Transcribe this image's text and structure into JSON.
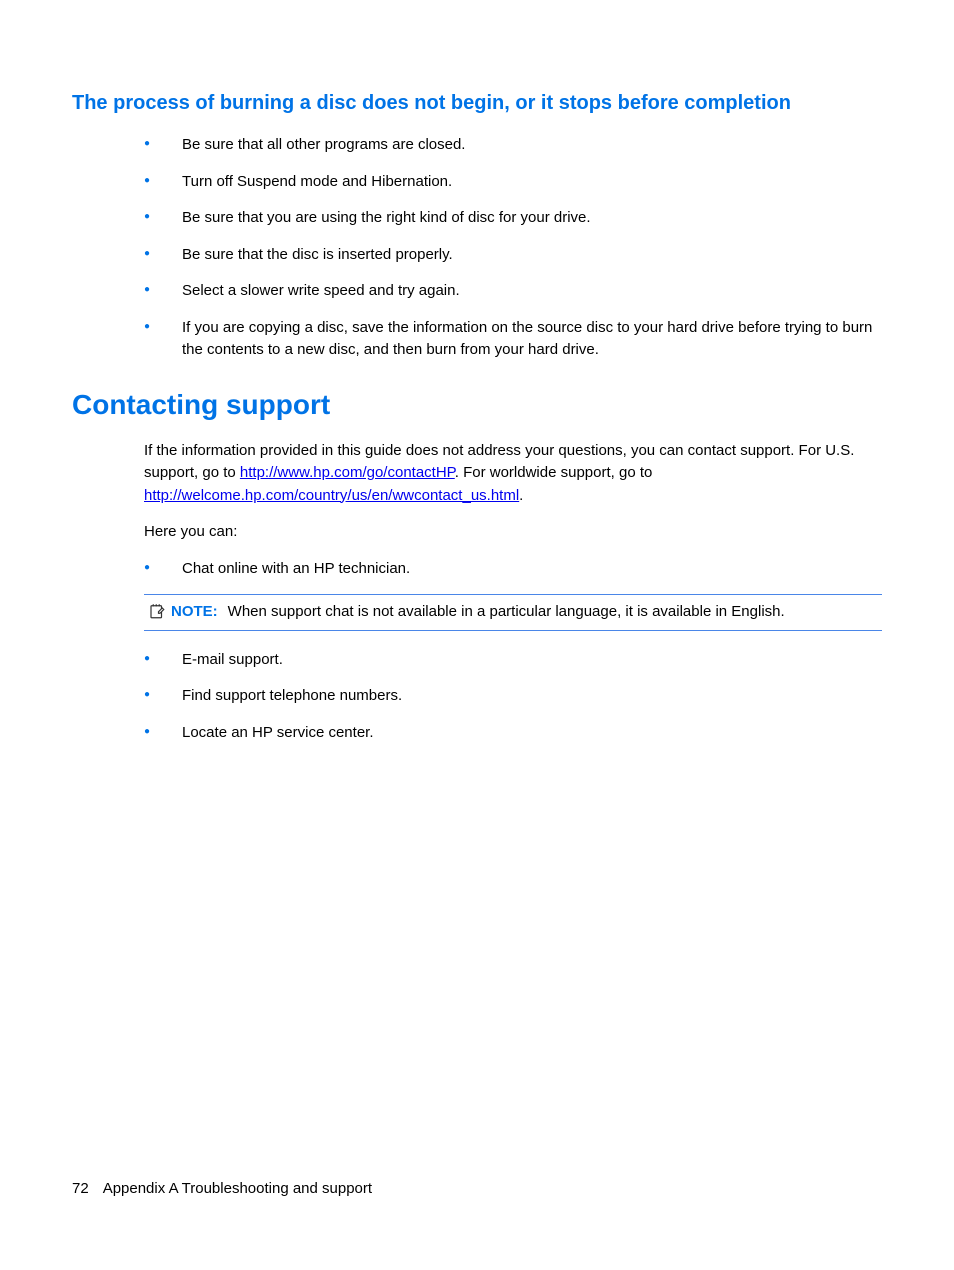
{
  "section1": {
    "heading": "The process of burning a disc does not begin, or it stops before completion",
    "bullets": [
      "Be sure that all other programs are closed.",
      "Turn off Suspend mode and Hibernation.",
      "Be sure that you are using the right kind of disc for your drive.",
      "Be sure that the disc is inserted properly.",
      "Select a slower write speed and try again.",
      "If you are copying a disc, save the information on the source disc to your hard drive before trying to burn the contents to a new disc, and then burn from your hard drive."
    ]
  },
  "section2": {
    "heading": "Contacting support",
    "intro_pre": "If the information provided in this guide does not address your questions, you can contact support. For U.S. support, go to ",
    "link1": "http://www.hp.com/go/contactHP",
    "intro_mid": ". For worldwide support, go to ",
    "link2": "http://welcome.hp.com/country/us/en/wwcontact_us.html",
    "intro_end": ".",
    "here_you_can": "Here you can:",
    "bullet1": "Chat online with an HP technician.",
    "note_label": "NOTE:",
    "note_text": "When support chat is not available in a particular language, it is available in English.",
    "bullets_after": [
      "E-mail support.",
      "Find support telephone numbers.",
      "Locate an HP service center."
    ]
  },
  "footer": {
    "page": "72",
    "appendix": "Appendix A   Troubleshooting and support"
  }
}
